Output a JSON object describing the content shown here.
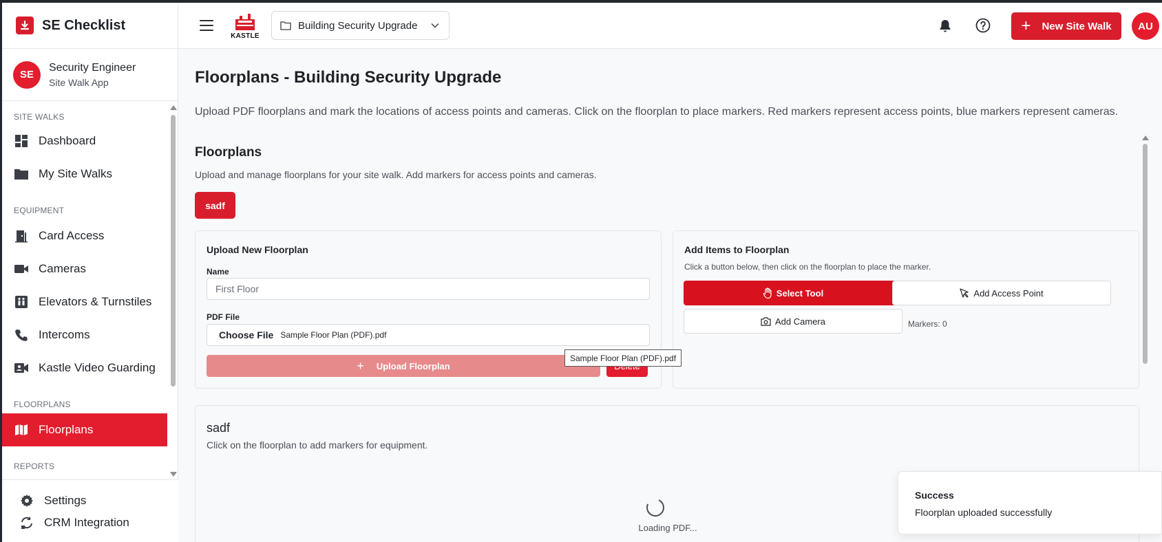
{
  "brand": {
    "title": "SE Checklist"
  },
  "profile": {
    "initials": "SE",
    "name": "Security Engineer",
    "subtitle": "Site Walk App"
  },
  "sidebar": {
    "sections": [
      {
        "label": "SITE WALKS",
        "items": [
          {
            "label": "Dashboard",
            "icon": "dashboard-icon"
          },
          {
            "label": "My Site Walks",
            "icon": "folder-icon"
          }
        ]
      },
      {
        "label": "EQUIPMENT",
        "items": [
          {
            "label": "Card Access",
            "icon": "door-icon"
          },
          {
            "label": "Cameras",
            "icon": "video-camera-icon"
          },
          {
            "label": "Elevators & Turnstiles",
            "icon": "elevator-icon"
          },
          {
            "label": "Intercoms",
            "icon": "phone-icon"
          },
          {
            "label": "Kastle Video Guarding",
            "icon": "video-call-icon"
          }
        ]
      },
      {
        "label": "FLOORPLANS",
        "items": [
          {
            "label": "Floorplans",
            "icon": "map-icon",
            "active": true
          }
        ]
      },
      {
        "label": "REPORTS",
        "items": []
      }
    ],
    "bottom": [
      {
        "label": "Settings",
        "icon": "gear-icon"
      },
      {
        "label": "CRM Integration",
        "icon": "sync-icon"
      }
    ]
  },
  "header": {
    "logo_text": "KASTLE",
    "project": "Building Security Upgrade",
    "new_button": "New Site Walk",
    "user_initials": "AU"
  },
  "main": {
    "title": "Floorplans - Building Security Upgrade",
    "description": "Upload PDF floorplans and mark the locations of access points and cameras. Click on the floorplan to place markers. Red markers represent access points, blue markers represent cameras.",
    "section_title": "Floorplans",
    "section_desc": "Upload and manage floorplans for your site walk. Add markers for access points and cameras.",
    "tab": "sadf",
    "upload": {
      "title": "Upload New Floorplan",
      "name_label": "Name",
      "name_placeholder": "First Floor",
      "file_label": "PDF File",
      "choose_label": "Choose File",
      "file_name": "Sample Floor Plan (PDF).pdf",
      "upload_button": "Upload Floorplan",
      "delete_button": "Delete",
      "tooltip": "Sample Floor Plan (PDF).pdf"
    },
    "items": {
      "title": "Add Items to Floorplan",
      "subtitle": "Click a button below, then click on the floorplan to place the marker.",
      "select_tool": "Select Tool",
      "add_access": "Add Access Point",
      "add_camera": "Add Camera",
      "markers": "Markers: 0"
    },
    "viewer": {
      "title": "sadf",
      "description": "Click on the floorplan to add markers for equipment.",
      "loading": "Loading PDF..."
    }
  },
  "toast": {
    "title": "Success",
    "message": "Floorplan uploaded successfully"
  },
  "colors": {
    "accent": "#d81e2c",
    "accent_light": "#e78a8c",
    "text": "#1f2328",
    "muted": "#4b5058"
  }
}
